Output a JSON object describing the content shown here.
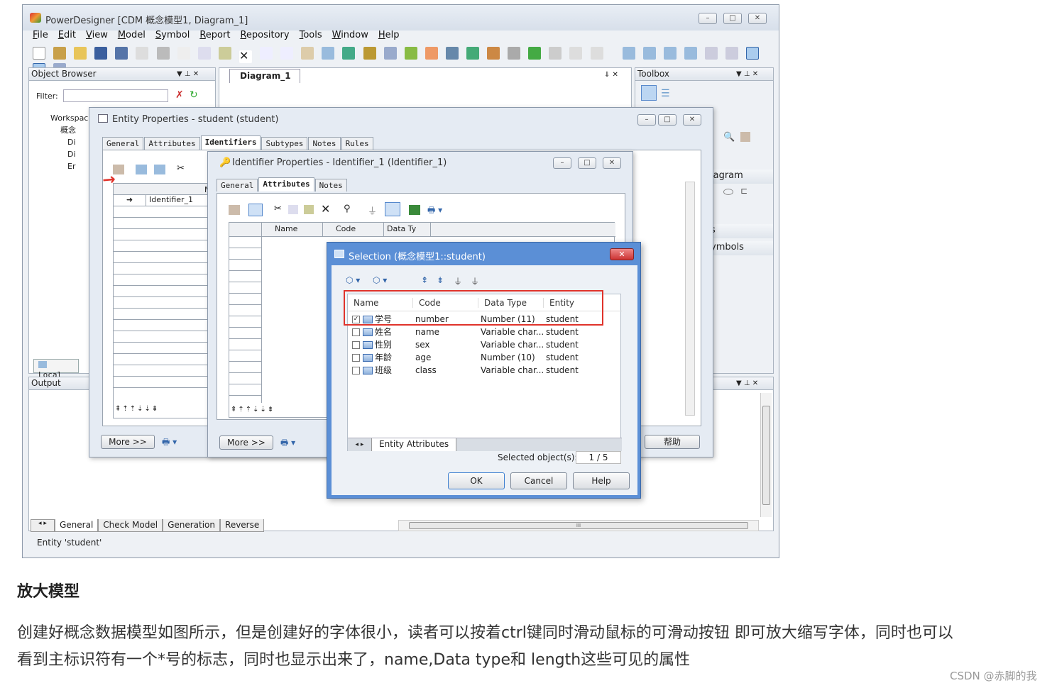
{
  "app": {
    "title": "PowerDesigner [CDM 概念模型1, Diagram_1]",
    "menu": [
      "File",
      "Edit",
      "View",
      "Model",
      "Symbol",
      "Report",
      "Repository",
      "Tools",
      "Window",
      "Help"
    ]
  },
  "object_browser": {
    "title": "Object Browser",
    "filter_label": "Filter:",
    "tree": [
      "Workspac",
      "概念",
      "Di",
      "Di",
      "Er"
    ],
    "local_tab": "Local"
  },
  "diagram_tab": "Diagram_1",
  "toolbox": {
    "title": "Toolbox",
    "section_diagram": "iagram",
    "section_symbols": "ymbols",
    "section_blank": "s"
  },
  "output": {
    "title": "Output",
    "tabs": [
      "General",
      "Check Model",
      "Generation",
      "Reverse"
    ],
    "status": "Entity 'student'",
    "scroll_mark": "III"
  },
  "entity_props": {
    "title": "Entity Properties - student (student)",
    "tabs": [
      "General",
      "Attributes",
      "Identifiers",
      "Subtypes",
      "Notes",
      "Rules"
    ],
    "active_tab": "Identifiers",
    "col_header": "N",
    "row1": "Identifier_1",
    "more_button": "More >>",
    "help_button": "帮助"
  },
  "identifier_props": {
    "title": "Identifier Properties - Identifier_1 (Identifier_1)",
    "tabs": [
      "General",
      "Attributes",
      "Notes"
    ],
    "active_tab": "Attributes",
    "columns": [
      "Name",
      "Code",
      "Data Ty"
    ],
    "more_button": "More >>"
  },
  "selection": {
    "title": "Selection (概念模型1::student)",
    "columns": [
      "Name",
      "Code",
      "Data Type",
      "Entity"
    ],
    "rows": [
      {
        "checked": true,
        "name": "学号",
        "code": "number",
        "type": "Number (11)",
        "entity": "student"
      },
      {
        "checked": false,
        "name": "姓名",
        "code": "name",
        "type": "Variable char...",
        "entity": "student"
      },
      {
        "checked": false,
        "name": "性别",
        "code": "sex",
        "type": "Variable char...",
        "entity": "student"
      },
      {
        "checked": false,
        "name": "年龄",
        "code": "age",
        "type": "Number (10)",
        "entity": "student"
      },
      {
        "checked": false,
        "name": "班级",
        "code": "class",
        "type": "Variable char...",
        "entity": "student"
      }
    ],
    "bottom_tab": "Entity Attributes",
    "selected_label": "Selected object(s):",
    "selected_value": "1 / 5",
    "ok": "OK",
    "cancel": "Cancel",
    "help": "Help"
  },
  "article": {
    "heading": "放大模型",
    "para_line1": "创建好概念数据模型如图所示，但是创建好的字体很小，读者可以按着ctrl键同时滑动鼠标的可滑动按钮 即可放大缩写字体，同时也可以",
    "para_line2": "看到主标识符有一个*号的标志，同时也显示出来了，name,Data type和 length这些可见的属性",
    "watermark": "CSDN @赤脚的我"
  },
  "colors": {
    "window_bg": "#f0f0f0",
    "title_gradient": "#dde6f2",
    "selection_red": "#e0332b",
    "dialog_blue": "#5b8fd6"
  }
}
